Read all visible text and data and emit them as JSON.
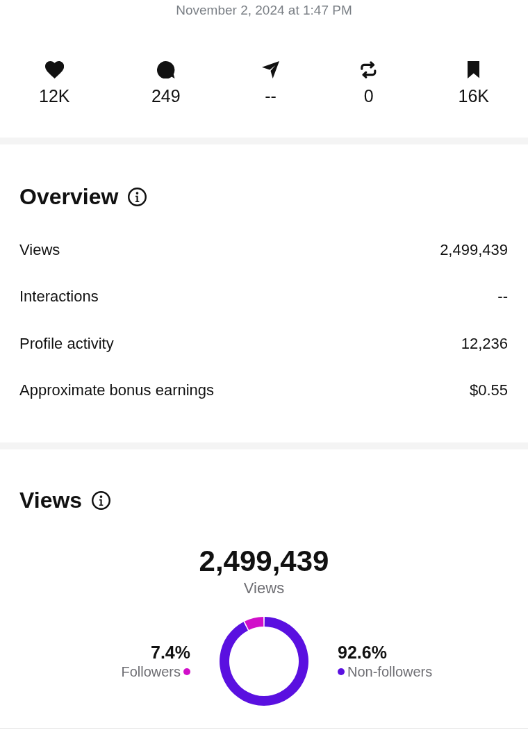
{
  "timestamp": "November 2, 2024 at 1:47 PM",
  "stats": [
    {
      "kind": "likes",
      "value": "12K"
    },
    {
      "kind": "comments",
      "value": "249"
    },
    {
      "kind": "shares",
      "value": "--"
    },
    {
      "kind": "reposts",
      "value": "0"
    },
    {
      "kind": "saves",
      "value": "16K"
    }
  ],
  "overview": {
    "title": "Overview",
    "rows": [
      {
        "label": "Views",
        "value": "2,499,439"
      },
      {
        "label": "Interactions",
        "value": "--"
      },
      {
        "label": "Profile activity",
        "value": "12,236"
      },
      {
        "label": "Approximate bonus earnings",
        "value": "$0.55"
      }
    ]
  },
  "views": {
    "title": "Views",
    "total": "2,499,439",
    "total_label": "Views",
    "legend": [
      {
        "percent": "7.4%",
        "color": "#d10fc9"
      },
      {
        "percent": "92.6%",
        "color": "#5a10e0"
      }
    ],
    "chart_data": {
      "type": "donut",
      "categories": [
        "Followers",
        "Non-followers"
      ],
      "values": [
        7.4,
        92.6
      ]
    }
  }
}
